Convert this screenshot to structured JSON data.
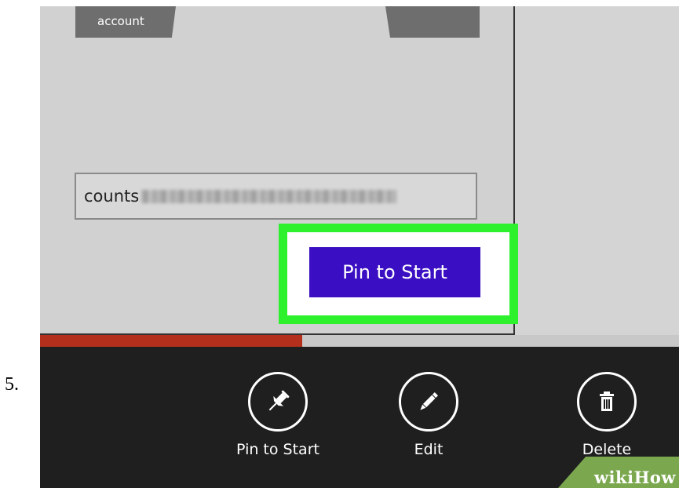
{
  "step": {
    "number": "5."
  },
  "dialog": {
    "account_tile_label": "account",
    "email_visible_text": "counts",
    "pin_button_label": "Pin to Start"
  },
  "progress": {
    "fraction": 0.41,
    "color": "#b5301c"
  },
  "app_bar": {
    "buttons": [
      {
        "label": "Pin to Start",
        "icon": "pin-icon"
      },
      {
        "label": "Edit",
        "icon": "pencil-icon"
      },
      {
        "label": "Delete",
        "icon": "trash-icon"
      }
    ]
  },
  "colors": {
    "pin_button_bg": "#3a0ec2",
    "highlight_border": "#2df12d",
    "app_bar_bg": "#1f1f1f",
    "dialog_bg": "#d1d1d1"
  },
  "watermark": {
    "text": "wikiHow"
  }
}
